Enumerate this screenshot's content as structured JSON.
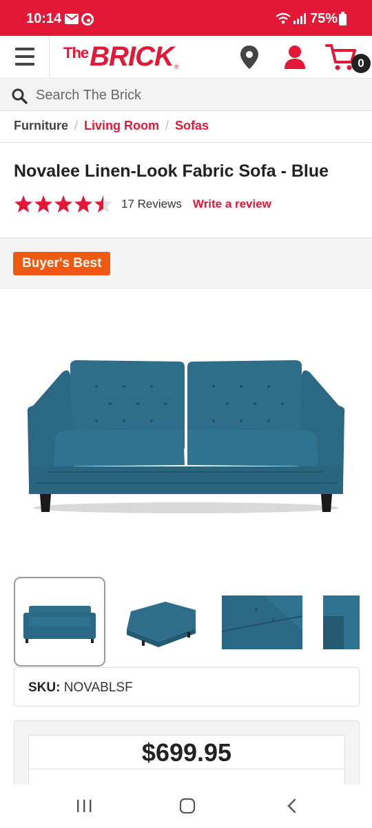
{
  "status_bar": {
    "time": "10:14",
    "battery_percent": "75%",
    "icons": [
      "mail-icon",
      "sync-icon",
      "wifi-icon",
      "signal-icon",
      "battery-icon"
    ]
  },
  "header": {
    "logo_the": "The",
    "logo_brick": "BRICK",
    "logo_reg": "®",
    "cart_count": "0",
    "icons": [
      "hamburger-menu-icon",
      "location-pin-icon",
      "account-icon",
      "cart-icon"
    ],
    "brand_color": "#e31837"
  },
  "search": {
    "placeholder": "Search The Brick"
  },
  "breadcrumb": {
    "items": [
      "Furniture",
      "Living Room",
      "Sofas"
    ],
    "separator": "/"
  },
  "product": {
    "title": "Novalee Linen-Look Fabric Sofa - Blue",
    "rating": 4.5,
    "rating_max": 5,
    "reviews_text": "17 Reviews",
    "write_review_label": "Write a review",
    "badge": "Buyer's Best",
    "badge_color": "#ee5a12",
    "sku_label": "SKU:",
    "sku_value": "NOVABLSF",
    "price": "$699.95",
    "thumbnail_count": 4
  },
  "nav_bar": {
    "buttons": [
      "recent-apps-icon",
      "home-icon",
      "back-icon"
    ]
  }
}
